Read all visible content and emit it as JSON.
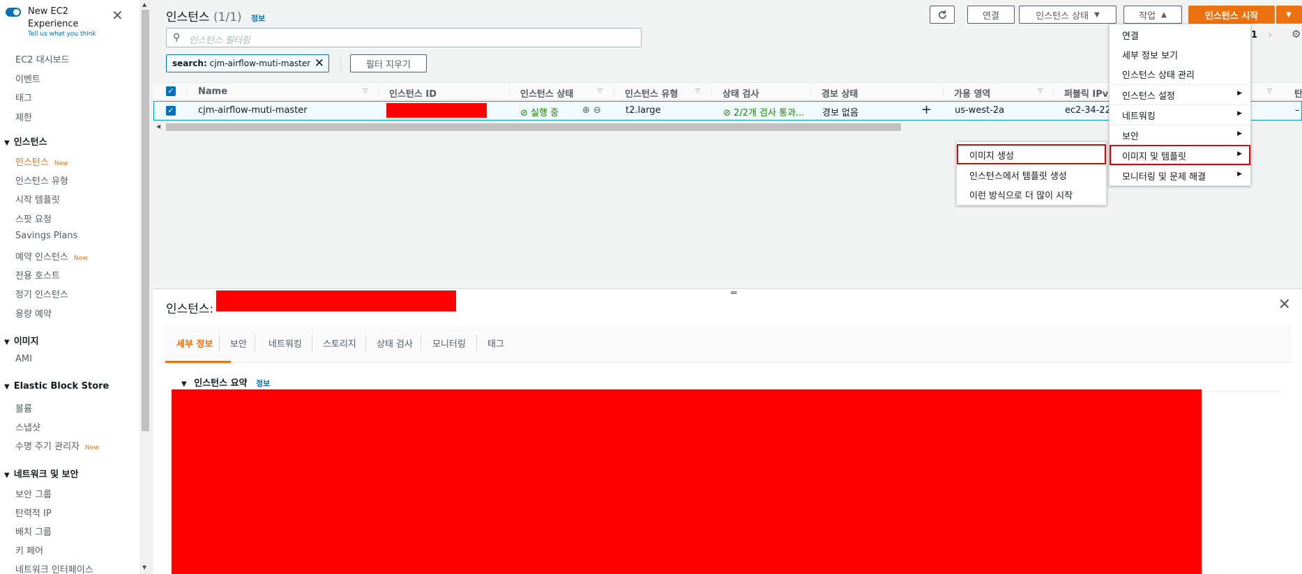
{
  "sidebar": {
    "new_exp_title": "New EC2 Experience",
    "new_exp_sub": "Tell us what you think",
    "close": "✕",
    "items_top": [
      "EC2 대시보드",
      "이벤트",
      "태그",
      "제한"
    ],
    "sections": [
      {
        "title": "인스턴스",
        "items": [
          {
            "label": "인스턴스",
            "new": "New",
            "active": true
          },
          {
            "label": "인스턴스 유형"
          },
          {
            "label": "시작 템플릿"
          },
          {
            "label": "스팟 요청"
          },
          {
            "label": "Savings Plans"
          },
          {
            "label": "예약 인스턴스",
            "new": "New"
          },
          {
            "label": "전용 호스트"
          },
          {
            "label": "정기 인스턴스"
          },
          {
            "label": "용량 예약"
          }
        ]
      },
      {
        "title": "이미지",
        "items": [
          {
            "label": "AMI"
          }
        ]
      },
      {
        "title": "Elastic Block Store",
        "items": [
          {
            "label": "볼륨"
          },
          {
            "label": "스냅샷"
          },
          {
            "label": "수명 주기 관리자",
            "new": "New"
          }
        ]
      },
      {
        "title": "네트워크 및 보안",
        "items": [
          {
            "label": "보안 그룹"
          },
          {
            "label": "탄력적 IP"
          },
          {
            "label": "배치 그룹"
          },
          {
            "label": "키 페어"
          },
          {
            "label": "네트워크 인터페이스"
          }
        ]
      }
    ]
  },
  "header": {
    "title": "인스턴스",
    "count": "(1/1)",
    "info": "정보",
    "buttons": {
      "connect": "연결",
      "instance_state": "인스턴스 상태",
      "actions": "작업",
      "launch": "인스턴스 시작"
    },
    "pagination_page": "1"
  },
  "filter": {
    "placeholder": "인스턴스 필터링",
    "token_key": "search:",
    "token_value": "cjm-airflow-muti-master",
    "clear": "필터 지우기"
  },
  "table": {
    "columns": [
      "Name",
      "인스턴스 ID",
      "인스턴스 상태",
      "인스턴스 유형",
      "상태 검사",
      "경보 상태",
      "가용 영역",
      "퍼블릭 IPv",
      "탄"
    ],
    "row": {
      "name": "cjm-airflow-muti-master",
      "state": "실행 중",
      "type": "t2.large",
      "status_check": "2/2개 검사 통과...",
      "alarm": "경보 없음",
      "az": "us-west-2a",
      "public_dns": "ec2-34-22",
      "last": "–"
    }
  },
  "actions_menu": {
    "items": [
      {
        "label": "연결"
      },
      {
        "label": "세부 정보 보기"
      },
      {
        "label": "인스턴스 상태 관리"
      },
      {
        "label": "인스턴스 설정",
        "sub": true
      },
      {
        "label": "네트워킹",
        "sub": true
      },
      {
        "label": "보안",
        "sub": true
      },
      {
        "label": "이미지 및 템플릿",
        "sub": true,
        "highlight": true
      },
      {
        "label": "모니터링 및 문제 해결",
        "sub": true
      }
    ]
  },
  "submenu": {
    "items": [
      "이미지 생성",
      "인스턴스에서 템플릿 생성",
      "이런 방식으로 더 많이 시작"
    ]
  },
  "detail": {
    "title": "인스턴스:",
    "tabs": [
      "세부 정보",
      "보안",
      "네트워킹",
      "스토리지",
      "상태 검사",
      "모니터링",
      "태그"
    ],
    "summary": "인스턴스 요약",
    "summary_info": "정보"
  },
  "colors": {
    "accent": "#ec7211",
    "link": "#0073bb",
    "success": "#1d8102",
    "redaction": "#ff0000",
    "highlight_outline": "#e00000"
  }
}
